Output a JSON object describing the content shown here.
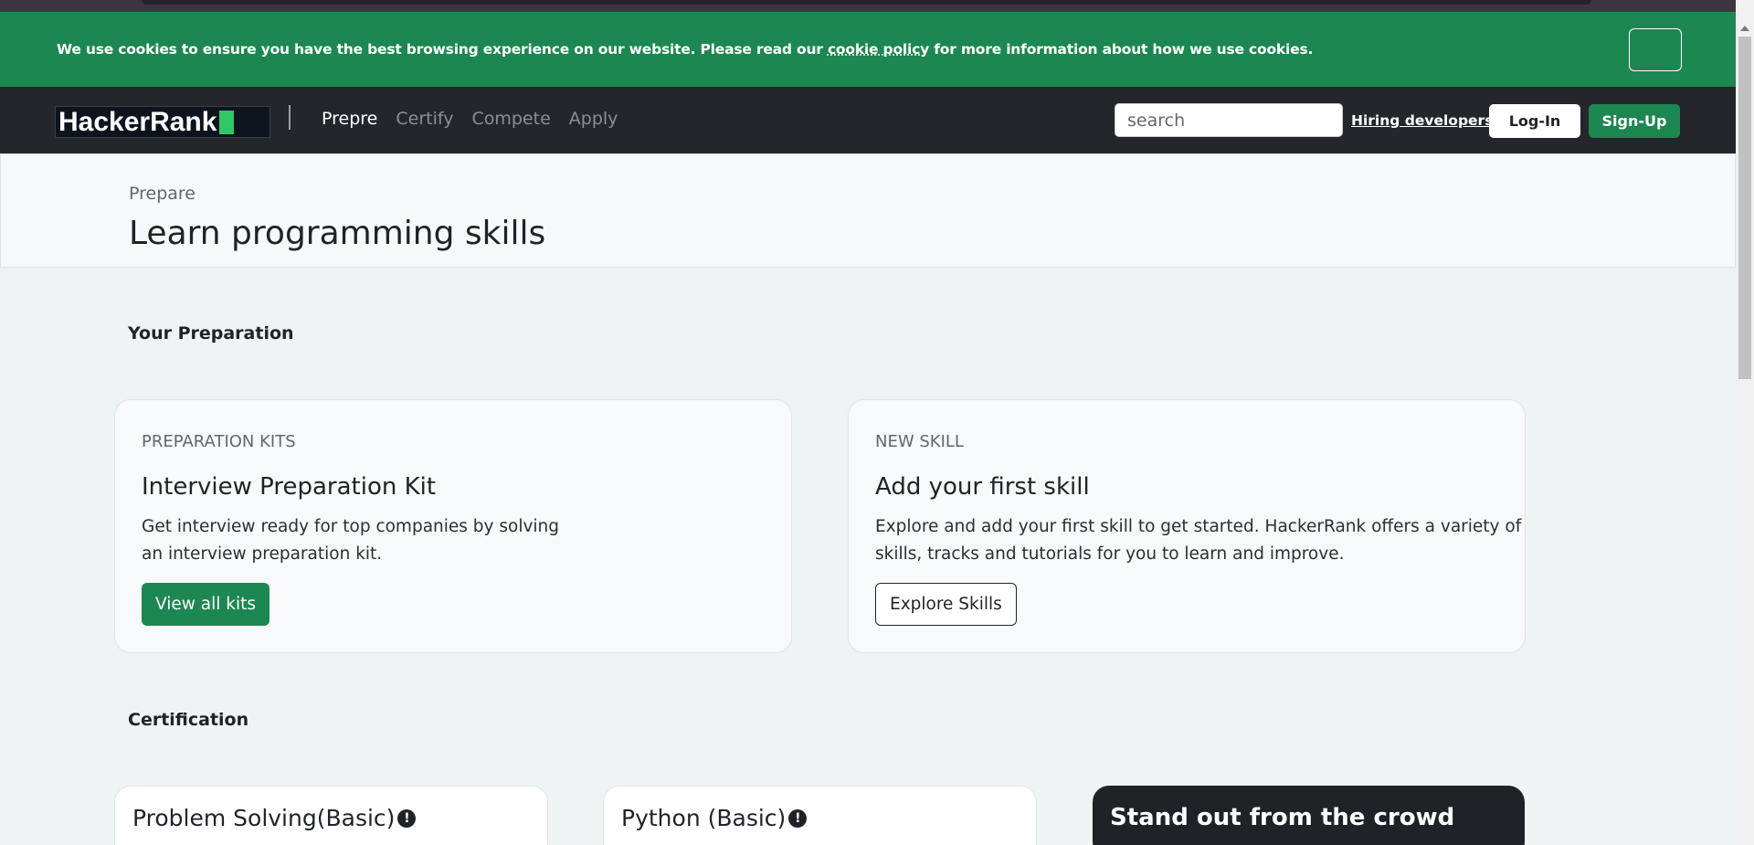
{
  "cookie_banner": {
    "text_before": "We use cookies to ensure you have the best browsing experience on our website. Please read our ",
    "link": "cookie policy",
    "text_after": " for more information about how we use cookies."
  },
  "nav": {
    "logo": "HackerRank",
    "links": [
      "Prepre",
      "Certify",
      "Compete",
      "Apply"
    ],
    "search_placeholder": "search",
    "hiring": "Hiring developers?",
    "login": "Log-In",
    "signup": "Sign-Up"
  },
  "hero": {
    "breadcrumb": "Prepare",
    "title": "Learn programming skills"
  },
  "preparation": {
    "heading": "Your Preparation",
    "cards": [
      {
        "overline": "PREPARATION KITS",
        "title": "Interview Preparation Kit",
        "desc_line1": "Get interview ready for top companies by solving",
        "desc_line2": "an interview preparation kit.",
        "button": "View all kits"
      },
      {
        "overline": "NEW SKILL",
        "title": "Add your first skill",
        "desc_line1": "Explore and add your first skill to get started. HackerRank offers a variety of",
        "desc_line2": "skills, tracks and tutorials for you to learn and improve.",
        "button": "Explore Skills"
      }
    ]
  },
  "certification": {
    "heading": "Certification",
    "cards": [
      "Problem Solving(Basic)",
      "Python (Basic)"
    ],
    "promo": "Stand out from the crowd"
  },
  "colors": {
    "brand_green": "#1c8751",
    "nav_dark": "#24262b",
    "logo_green": "#2ec866"
  }
}
